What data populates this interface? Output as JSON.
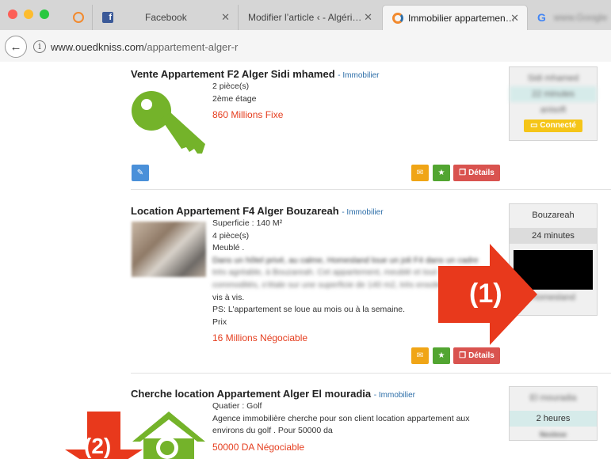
{
  "browser": {
    "tabs": [
      {
        "label": "",
        "icon": "qwant-icon"
      },
      {
        "label": "Facebook",
        "icon": "facebook-icon"
      },
      {
        "label": "Modifier l’article ‹ - Algéri…",
        "icon": ""
      },
      {
        "label": "Immobilier appartemen…",
        "icon": "ouedkniss-icon"
      },
      {
        "label": "",
        "icon": "google-icon"
      }
    ],
    "url_host": "www.ouedkniss.com",
    "url_path": "/appartement-alger-r"
  },
  "listings": [
    {
      "title": "Vente Appartement F2 Alger Sidi mhamed",
      "category": "- Immobilier",
      "lines": [
        "2 pièce(s)",
        "2ème étage"
      ],
      "price": "860 Millions Fixe",
      "side": {
        "location": "Sidi mhamed",
        "time": "22 minutes",
        "extra": "anisoft",
        "badge": "Connecté"
      },
      "buttons": {
        "details": "Détails"
      }
    },
    {
      "title": "Location Appartement F4 Alger Bouzareah",
      "category": "- Immobilier",
      "lines": [
        "Superficie : 140 M²",
        "4 pièce(s)",
        "Meublé ."
      ],
      "desc_blur": [
        "Dans un hôtel privé, au calme, Homesland loue un joli F4 dans un cadre",
        "très agréable, à Bouzareah. Cet appartement, meublé et tout confort",
        "commodités, s'étale sur une superficie de 140 m2, très ensoleillé avec"
      ],
      "desc_tail": [
        "vis à vis.",
        "PS: L'appartement se loue au mois ou à la semaine.",
        "Prix"
      ],
      "price": "16 Millions Négociable",
      "side": {
        "location": "Bouzareah",
        "time": "24 minutes",
        "user": "Homesland"
      },
      "buttons": {
        "details": "Détails"
      }
    },
    {
      "title": "Cherche location Appartement Alger El mouradia",
      "category": "- Immobilier",
      "lines": [
        "Quatier : Golf",
        "Agence immobilière cherche pour son client location appartement aux",
        "environs du golf . Pour 50000 da"
      ],
      "price": "50000 DA Négociable",
      "side": {
        "location": "El mouradia",
        "time": "2 heures",
        "user": "Nexlese"
      }
    }
  ],
  "annotations": {
    "one": "(1)",
    "two": "(2)"
  },
  "colors": {
    "accent_red": "#e53d1e",
    "arrow_red": "#e8391c",
    "key_green": "#74b32a",
    "category_blue": "#2d6ea8"
  }
}
